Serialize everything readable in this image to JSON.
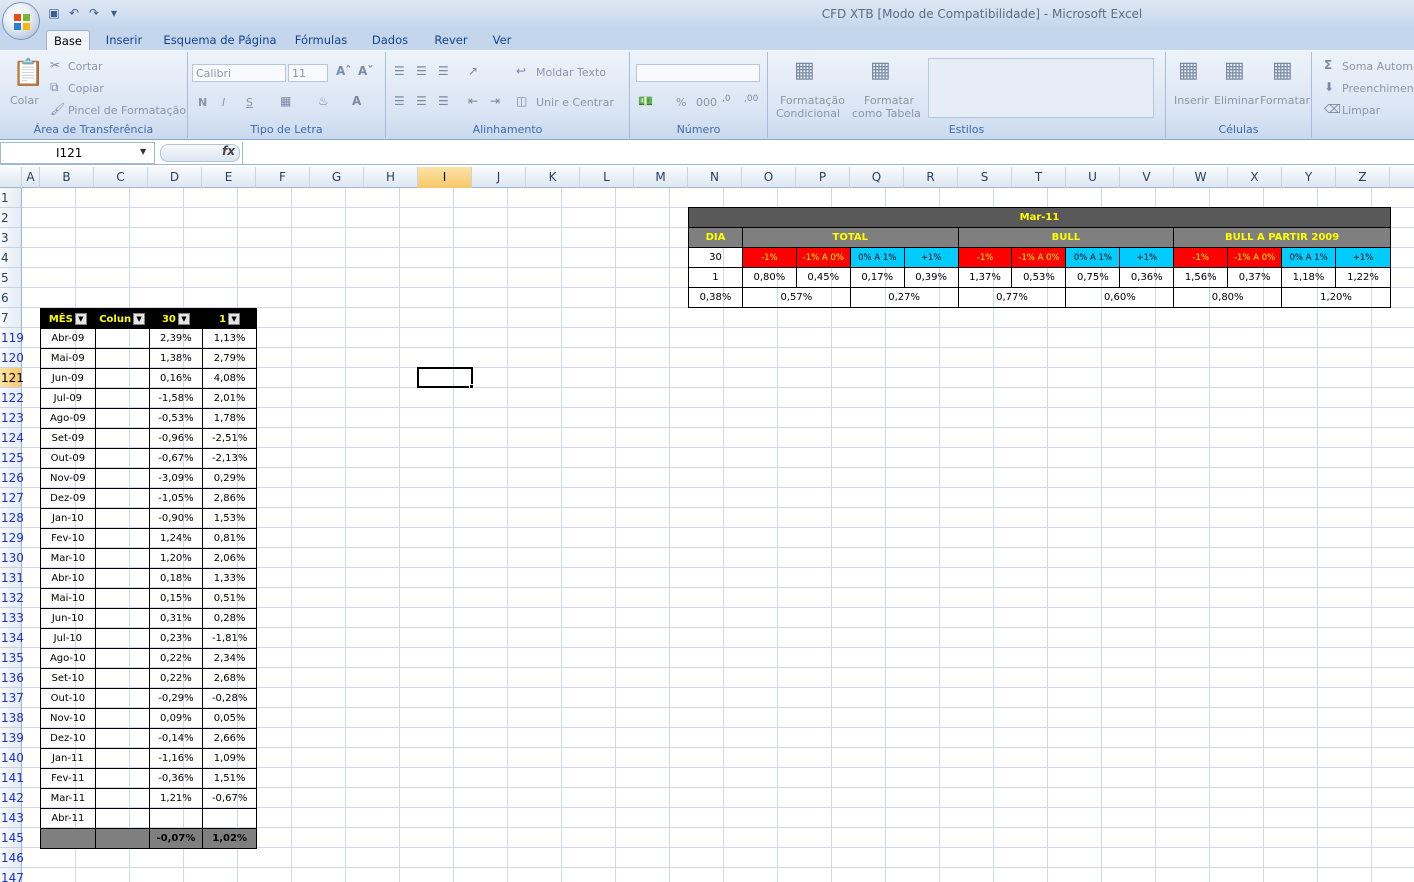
{
  "window": {
    "title": "CFD XTB  [Modo de Compatibilidade] - Microsoft Excel"
  },
  "ribbon": {
    "tabs": [
      "Base",
      "Inserir",
      "Esquema de Página",
      "Fórmulas",
      "Dados",
      "Rever",
      "Ver"
    ],
    "active_tab": "Base",
    "clipboard": {
      "paste": "Colar",
      "cut": "Cortar",
      "copy": "Copiar",
      "format_painter": "Pincel de Formatação",
      "label": "Área de Transferência"
    },
    "font": {
      "name": "Calibri",
      "size": "11",
      "bold": "N",
      "italic": "I",
      "underline": "S",
      "label": "Tipo de Letra"
    },
    "alignment": {
      "wrap": "Moldar Texto",
      "merge": "Unir e Centrar",
      "label": "Alinhamento"
    },
    "number": {
      "percent": "%",
      "thousands": "000",
      "label": "Número"
    },
    "styles": {
      "conditional_1": "Formatação",
      "conditional_2": "Condicional",
      "table_1": "Formatar",
      "table_2": "como Tabela",
      "label": "Estilos"
    },
    "cells": {
      "insert": "Inserir",
      "delete": "Eliminar",
      "format": "Formatar",
      "label": "Células"
    },
    "editing": {
      "autosum": "Soma Automá",
      "fill": "Preenchiment",
      "clear": "Limpar"
    }
  },
  "formula_bar": {
    "name_box": "I121",
    "fx": "fx",
    "value": ""
  },
  "columns": [
    "A",
    "B",
    "C",
    "D",
    "E",
    "F",
    "G",
    "H",
    "I",
    "J",
    "K",
    "L",
    "M",
    "N",
    "O",
    "P",
    "Q",
    "R",
    "S",
    "T",
    "U",
    "V",
    "W",
    "X",
    "Y",
    "Z"
  ],
  "selected_column": "I",
  "rows": [
    "1",
    "2",
    "3",
    "4",
    "5",
    "6",
    "7",
    "119",
    "120",
    "121",
    "122",
    "123",
    "124",
    "125",
    "126",
    "127",
    "128",
    "129",
    "130",
    "131",
    "132",
    "133",
    "134",
    "135",
    "136",
    "137",
    "138",
    "139",
    "140",
    "141",
    "142",
    "143",
    "145",
    "146",
    "147"
  ],
  "selected_row": "121",
  "monthly_table": {
    "headers": [
      "MÊS",
      "Colun",
      "30",
      "1"
    ],
    "rows": [
      [
        "Abr-09",
        "",
        "2,39%",
        "1,13%"
      ],
      [
        "Mai-09",
        "",
        "1,38%",
        "2,79%"
      ],
      [
        "Jun-09",
        "",
        "0,16%",
        "4,08%"
      ],
      [
        "Jul-09",
        "",
        "-1,58%",
        "2,01%"
      ],
      [
        "Ago-09",
        "",
        "-0,53%",
        "1,78%"
      ],
      [
        "Set-09",
        "",
        "-0,96%",
        "-2,51%"
      ],
      [
        "Out-09",
        "",
        "-0,67%",
        "-2,13%"
      ],
      [
        "Nov-09",
        "",
        "-3,09%",
        "0,29%"
      ],
      [
        "Dez-09",
        "",
        "-1,05%",
        "2,86%"
      ],
      [
        "Jan-10",
        "",
        "-0,90%",
        "1,53%"
      ],
      [
        "Fev-10",
        "",
        "1,24%",
        "0,81%"
      ],
      [
        "Mar-10",
        "",
        "1,20%",
        "2,06%"
      ],
      [
        "Abr-10",
        "",
        "0,18%",
        "1,33%"
      ],
      [
        "Mai-10",
        "",
        "0,15%",
        "0,51%"
      ],
      [
        "Jun-10",
        "",
        "0,31%",
        "0,28%"
      ],
      [
        "Jul-10",
        "",
        "0,23%",
        "-1,81%"
      ],
      [
        "Ago-10",
        "",
        "0,22%",
        "2,34%"
      ],
      [
        "Set-10",
        "",
        "0,22%",
        "2,68%"
      ],
      [
        "Out-10",
        "",
        "-0,29%",
        "-0,28%"
      ],
      [
        "Nov-10",
        "",
        "0,09%",
        "0,05%"
      ],
      [
        "Dez-10",
        "",
        "-0,14%",
        "2,66%"
      ],
      [
        "Jan-11",
        "",
        "-1,16%",
        "1,09%"
      ],
      [
        "Fev-11",
        "",
        "-0,36%",
        "1,51%"
      ],
      [
        "Mar-11",
        "",
        "1,21%",
        "-0,67%"
      ],
      [
        "Abr-11",
        "",
        "",
        ""
      ]
    ],
    "totals": [
      "",
      "",
      "-0,07%",
      "1,02%"
    ]
  },
  "summary_table": {
    "title": "Mar-11",
    "dia_label": "DIA",
    "groups": [
      "TOTAL",
      "BULL",
      "BULL A PARTIR 2009"
    ],
    "buckets": [
      "-1%",
      "-1% A 0%",
      "0% A 1%",
      "+1%"
    ],
    "day_value": "30",
    "count_value": "1",
    "values": [
      "0,80%",
      "0,45%",
      "0,17%",
      "0,39%",
      "1,37%",
      "0,53%",
      "0,75%",
      "0,36%",
      "1,56%",
      "0,37%",
      "1,18%",
      "1,22%"
    ],
    "first_avg": "0,38%",
    "pair_avgs": [
      "0,57%",
      "0,27%",
      "0,77%",
      "0,60%",
      "0,80%",
      "1,20%"
    ]
  }
}
